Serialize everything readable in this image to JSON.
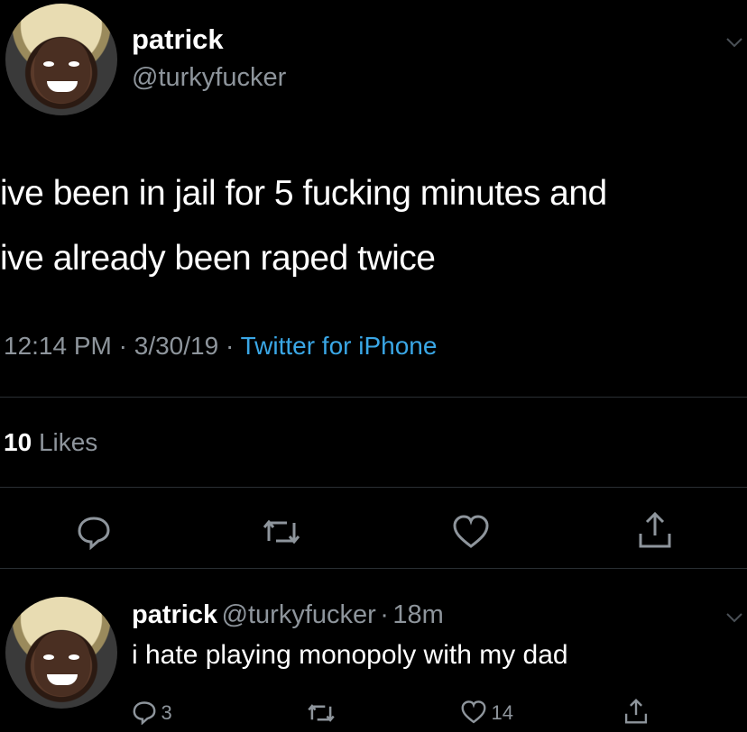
{
  "tweet": {
    "display_name": "patrick",
    "handle": "@turkyfucker",
    "text_line1": "ive been in jail for 5 fucking minutes and",
    "text_line2": "ive already been raped twice",
    "time": "12:14 PM",
    "date": "3/30/19",
    "source": "Twitter for iPhone",
    "sep": "·",
    "likes_count": "10",
    "likes_label": "Likes"
  },
  "reply": {
    "display_name": "patrick",
    "handle": "@turkyfucker",
    "age": "18m",
    "sep": "·",
    "text": "i hate playing monopoly with my dad",
    "reply_count": "3",
    "like_count": "14"
  },
  "icons": [
    "chevron-down-icon",
    "reply-icon",
    "retweet-icon",
    "like-icon",
    "share-icon"
  ],
  "colors": {
    "background": "#000000",
    "text": "#ffffff",
    "muted": "#8e959c",
    "link": "#3aa7e6"
  }
}
